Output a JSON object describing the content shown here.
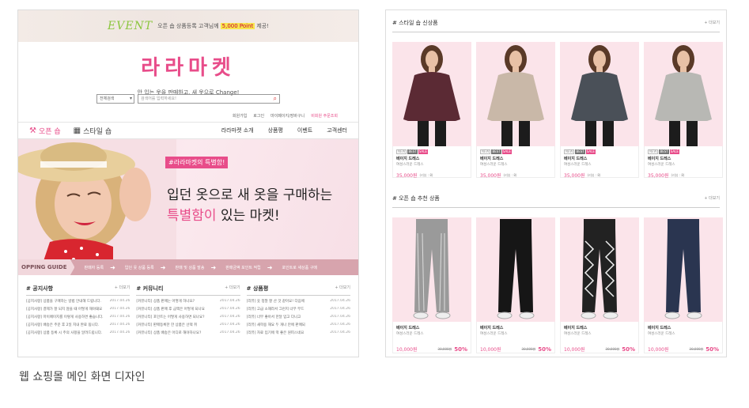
{
  "left": {
    "event": {
      "label": "EVENT",
      "text": "오픈 숍  상품등록  고객님께",
      "point": "5,000 Point",
      "suffix": "제공!"
    },
    "logo": "라라마켓",
    "tagline": "안 입는 옷을 판매하고, 새 옷으로 Change!",
    "search": {
      "select": "전체검색",
      "placeholder": "검색어를 입력하세요!"
    },
    "util_links": [
      "회원가입",
      "로그인",
      "마이페이지/장바구니",
      "비회원 주문조회"
    ],
    "nav": {
      "open_shop": "오픈 숍",
      "style_shop": "스타일 숍",
      "menu": [
        "라라마켓 소개",
        "상품평",
        "이벤트",
        "고객센터"
      ]
    },
    "hero": {
      "badge": "#라라마켓의 특별함!",
      "line1": "입던 옷으로 새 옷을 구매하는",
      "line2_highlight": "특별함이",
      "line2_rest": " 있는 마켓!"
    },
    "guide": {
      "label": "OPPING GUIDE",
      "steps": [
        "판매자 등록",
        "입던 옷 상품 등록",
        "판매 및 상품 발송",
        "판매금액 포인트 적립",
        "포인트로 새상품 구매"
      ]
    },
    "boards": [
      {
        "title": "# 공지사항",
        "more": "+ 더보기",
        "items": [
          {
            "t": "[공지사항] 상품을 구매하는 방법 안내해 드립니다.",
            "d": "2017.04.26"
          },
          {
            "t": "[공지사항] 결제가 잘 되지 않을 때 어떻게 해야돼요",
            "d": "2017.04.26"
          },
          {
            "t": "[공지사항] 마이페이지를 이렇게 사용하면 좋습니다.",
            "d": "2017.04.26"
          },
          {
            "t": "[공지사항] 배송은 주문 후 2일 지내 완료 됩니다.",
            "d": "2017.04.26"
          },
          {
            "t": "[공지사항] 상품 등록 시 주의 사항을 알려드립니다.",
            "d": "2017.04.26"
          }
        ]
      },
      {
        "title": "# 커뮤니티",
        "more": "+ 더보기",
        "items": [
          {
            "t": "[커뮤니티] 상품 판매는 어떻게 하나요?",
            "d": "2017.04.26"
          },
          {
            "t": "[커뮤니티] 상품 판매 후 금액은 어떻게 되나요",
            "d": "2017.04.26"
          },
          {
            "t": "[커뮤니티] 포인트는 어떻게 사용하면 되나요?",
            "d": "2017.04.26"
          },
          {
            "t": "[커뮤니티] 판매등록한 한 상품은 선택 취",
            "d": "2017.04.26"
          },
          {
            "t": "[커뮤니티] 상품 배송은 어디로 해야하나요?",
            "d": "2017.04.26"
          }
        ]
      },
      {
        "title": "# 상품평",
        "more": "+ 더보기",
        "items": [
          {
            "t": "[리뷰] 옷 정말 잘 산 것 같아요! 다음에",
            "d": "2017.04.26"
          },
          {
            "t": "[리뷰] 고급 소재라서 그런지 너무 부드",
            "d": "2017.04.26"
          },
          {
            "t": "[리뷰] 너무 좋아서 한달 입고 다니고",
            "d": "2017.04.26"
          },
          {
            "t": "[리뷰] 새학용 해요 두 개나 만에 판매되",
            "d": "2017.04.26"
          },
          {
            "t": "[리뷰] 자료 입기에 딱 좋은 원피스네요",
            "d": "2017.04.26"
          }
        ]
      }
    ]
  },
  "caption": "웹 쇼핑몰 메인 화면 디자인",
  "right": {
    "style_section": {
      "title": "# 스타일 숍 신상품",
      "more": "+ 더보기",
      "products": [
        {
          "name": "베이지 드레스",
          "sub": "여성스러운 드레스",
          "price": "35,000원",
          "reviews": "(리뷰 : 8)",
          "top_color": "#5b2a34",
          "badges": [
            "NEW",
            "BEST",
            "SALE"
          ]
        },
        {
          "name": "베이지 드레스",
          "sub": "여성스러운 드레스",
          "price": "35,000원",
          "reviews": "(리뷰 : 8)",
          "top_color": "#c9b8a8",
          "badges": [
            "NEW",
            "BEST",
            "SALE"
          ]
        },
        {
          "name": "베이지 드레스",
          "sub": "여성스러운 드레스",
          "price": "35,000원",
          "reviews": "(리뷰 : 8)",
          "top_color": "#4a5058",
          "badges": [
            "NEW",
            "BEST",
            "SALE"
          ]
        },
        {
          "name": "베이지 드레스",
          "sub": "여성스러운 드레스",
          "price": "35,000원",
          "reviews": "(리뷰 : 8)",
          "top_color": "#b8b8b4",
          "badges": [
            "NEW",
            "BEST",
            "SALE"
          ]
        }
      ]
    },
    "open_section": {
      "title": "# 오픈 숍 추천 상품",
      "more": "+ 더보기",
      "products": [
        {
          "name": "베이지 드레스",
          "sub": "여성스러운 드레스",
          "price": "10,000원",
          "orig": "30,000원",
          "pct": "50%",
          "pants_color": "#9a9a9a"
        },
        {
          "name": "베이지 드레스",
          "sub": "여성스러운 드레스",
          "price": "10,000원",
          "orig": "30,000원",
          "pct": "50%",
          "pants_color": "#161616"
        },
        {
          "name": "베이지 드레스",
          "sub": "여성스러운 드레스",
          "price": "10,000원",
          "orig": "30,000원",
          "pct": "50%",
          "pants_color": "#222222"
        },
        {
          "name": "베이지 드레스",
          "sub": "여성스러운 드레스",
          "price": "10,000원",
          "orig": "30,000원",
          "pct": "50%",
          "pants_color": "#2a3550"
        }
      ]
    }
  }
}
